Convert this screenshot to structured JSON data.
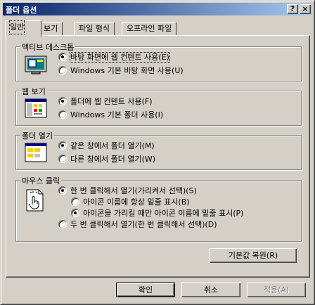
{
  "window": {
    "title": "폴더 옵션",
    "help_icon": "?",
    "close_icon": "×"
  },
  "tabs": [
    {
      "label": "일반",
      "active": true
    },
    {
      "label": "보기",
      "active": false
    },
    {
      "label": "파일 형식",
      "active": false
    },
    {
      "label": "오프라인 파일",
      "active": false
    }
  ],
  "groups": {
    "active_desktop": {
      "title": "액티브 데스크톱",
      "options": [
        {
          "label": "바탕 화면에 웹 컨텐트 사용(E)",
          "selected": true
        },
        {
          "label": "Windows 기본 바탕 화면 사용(U)",
          "selected": false
        }
      ],
      "icon": "desktop-icon"
    },
    "web_view": {
      "title": "웹 보기",
      "options": [
        {
          "label": "폴더에 웹 컨텐트 사용(F)",
          "selected": true
        },
        {
          "label": "Windows 기본 폴더 사용(I)",
          "selected": false
        }
      ],
      "icon": "web-folder-icon"
    },
    "open_folder": {
      "title": "폴더 열기",
      "options": [
        {
          "label": "같은 창에서 폴더 열기(M)",
          "selected": true
        },
        {
          "label": "다른 창에서 폴더 열기(W)",
          "selected": false
        }
      ],
      "icon": "window-icon"
    },
    "mouse_click": {
      "title": "마우스 클릭",
      "options": [
        {
          "label": "한 번 클릭해서 열기(가리켜서 선택)(S)",
          "selected": true
        },
        {
          "label": "아이콘 이름에 항상 밑줄 표시(B)",
          "selected": false
        },
        {
          "label": "아이콘을 가리킬 때만 아이콘 이름에 밑줄 표시(P)",
          "selected": true
        },
        {
          "label": "두 번 클릭해서 열기(한 번 클릭해서 선택)(D)",
          "selected": false
        }
      ],
      "icon": "hand-pointer-icon"
    }
  },
  "buttons": {
    "restore_defaults": "기본값 복원(R)",
    "ok": "확인",
    "cancel": "취소",
    "apply": "적용(A)"
  },
  "colors": {
    "titlebar_start": "#0a246a",
    "titlebar_end": "#a6caf0",
    "face": "#d4d0c8"
  }
}
